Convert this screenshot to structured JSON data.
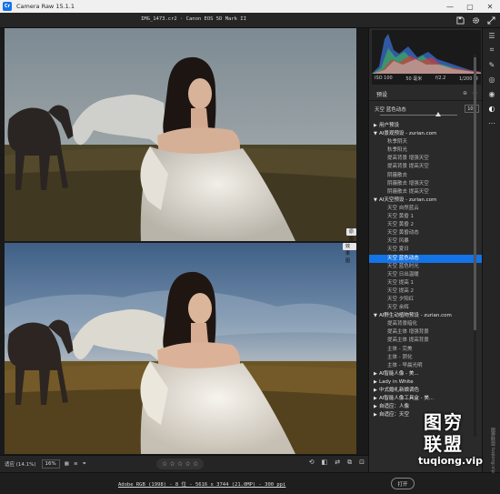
{
  "app": {
    "title": "Camera Raw 15.1.1",
    "icon_label": "Cr"
  },
  "window_controls": [
    "—",
    "▢",
    "✕"
  ],
  "file_info": "IMG_1473.cr2 · Canon EOS 5D Mark II",
  "top_icons": [
    "save-icon",
    "gear-icon",
    "expand-icon"
  ],
  "preview": {
    "before_tag": "原图",
    "after_tag": "效果图"
  },
  "bottom": {
    "fit_label": "适应 (14.1%)",
    "zoom": "16%",
    "stars": "☆ ☆ ☆ ☆ ☆",
    "icons": [
      "filmstrip-icon",
      "sort-icon",
      "filter-icon"
    ]
  },
  "status": {
    "link": "Adobe RGB (1998) - 8 位 - 5616 x 3744 (21.0MP) - 300 ppi",
    "open_button": "打开"
  },
  "histogram": {
    "iso": "ISO 100",
    "focal": "50 毫米",
    "aperture": "f/2.2",
    "shutter": "1/200 秒"
  },
  "presets": {
    "title": "预设",
    "selected_name": "天空 蓝色动态",
    "amount": "100",
    "amount_fraction": 0.75,
    "groups": [
      {
        "name": "用户预设",
        "expanded": false,
        "items": []
      },
      {
        "name": "AI景观预设 - zurian.com",
        "expanded": true,
        "items": [
          "秋季阴天",
          "秋季阳光",
          "提高背景 增强天空",
          "提高背景 提高天空",
          "阴霾散去",
          "阴霾散去 增强天空",
          "阴霾散去 提高天空"
        ]
      },
      {
        "name": "AI天空预设 - zurian.com",
        "expanded": true,
        "items": [
          "天空 自然蓝云",
          "天空 黄昏 1",
          "天空 黄昏 2",
          "天空 黄昏动态",
          "天空 风暴",
          "天空 夏日",
          "天空 蓝色动态",
          "天空 蓝色时光",
          "天空 日出温暖",
          "天空 提高 1",
          "天空 提高 2",
          "天空 夕阳红",
          "天空 余辉"
        ]
      },
      {
        "name": "AI野生动植物预设 - zurian.com",
        "expanded": true,
        "items": [
          "提高背景暗化",
          "提高主体 增强背景",
          "提高主体 提高背景",
          "主体 - 完美",
          "主体 - 阴化",
          "主体 - 早晨光明"
        ]
      },
      {
        "name": "AI智能人像 - 美...",
        "expanded": false,
        "items": []
      },
      {
        "name": "Lady in White",
        "expanded": false,
        "items": []
      },
      {
        "name": "中式婚礼新娘调色",
        "expanded": false,
        "items": []
      },
      {
        "name": "AI智能人像工具盒 - 美...",
        "expanded": false,
        "items": []
      },
      {
        "name": "自适应：人像",
        "expanded": false,
        "items": []
      },
      {
        "name": "自适应：天空",
        "expanded": false,
        "items": []
      }
    ]
  },
  "tools": [
    "edit-sliders-icon",
    "crop-icon",
    "heal-icon",
    "mask-icon",
    "redeye-icon",
    "presets-icon",
    "more-icon",
    "snapshots-icon"
  ],
  "side_text": "图旁联盟 tuqiong.vip",
  "watermark": {
    "line1": "图穷",
    "line2": "联盟",
    "url": "tuqiong.vip"
  }
}
